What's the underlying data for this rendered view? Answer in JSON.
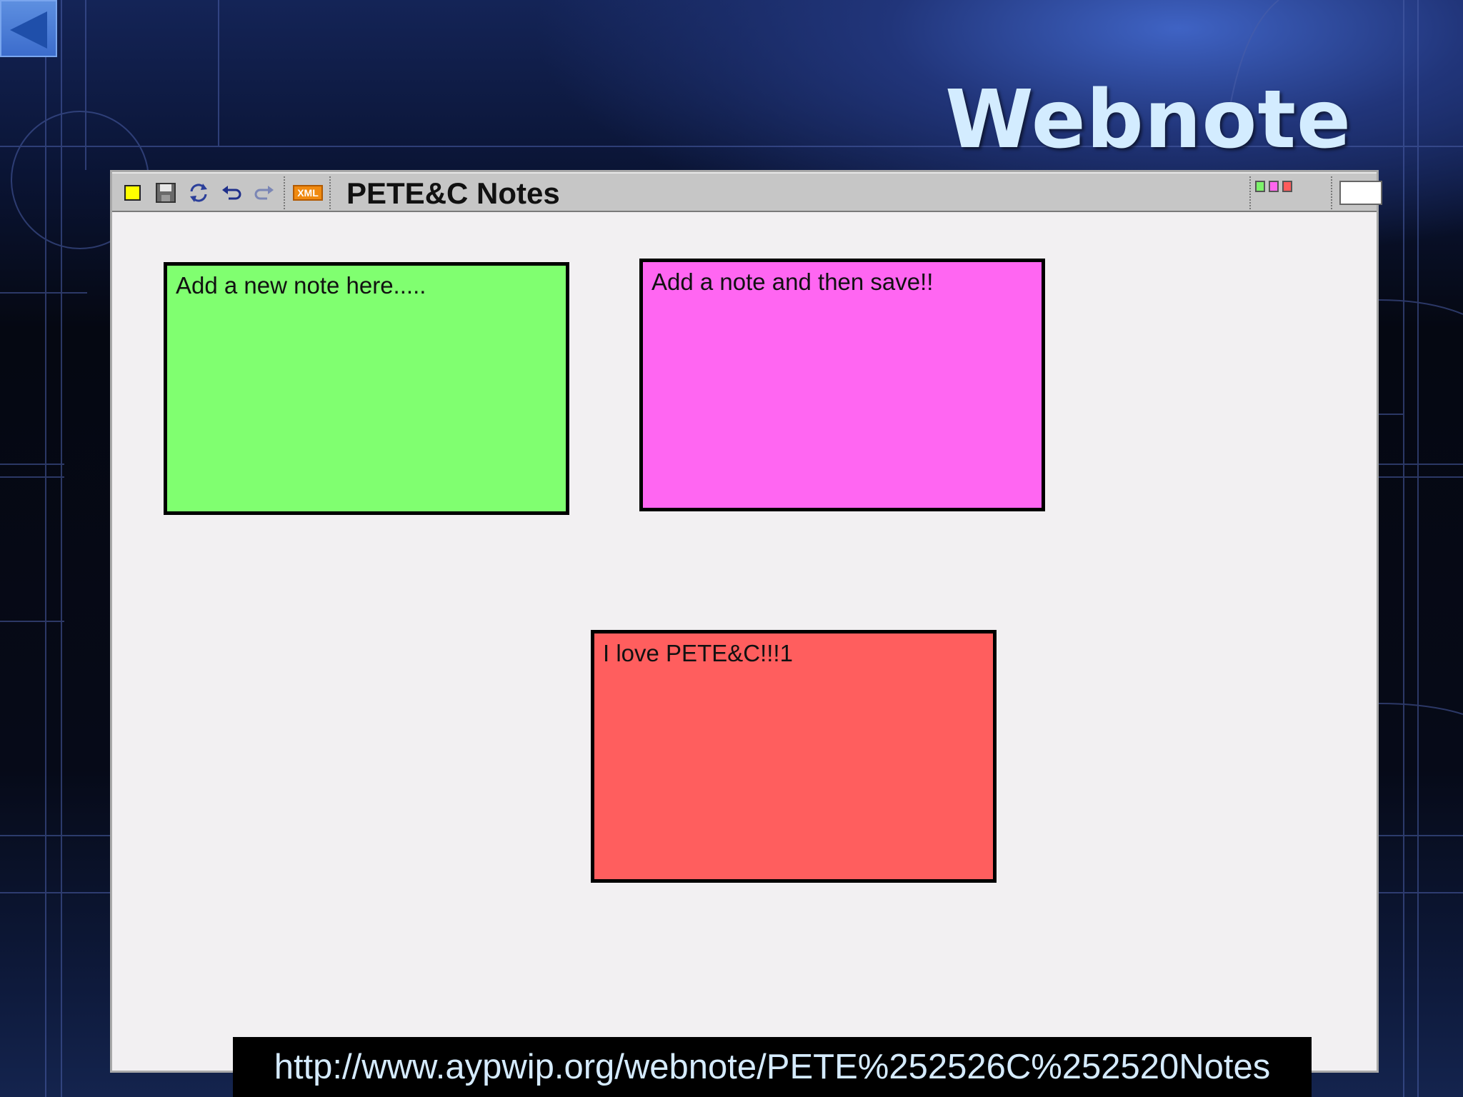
{
  "slide": {
    "title": "Webnote",
    "url": "http://www.aypwip.org/webnote/PETE%252526C%252520Notes"
  },
  "app": {
    "notebook_title": "PETE&C Notes",
    "toolbar": {
      "icons": [
        "new-note-icon",
        "save-icon",
        "reload-icon",
        "undo-icon",
        "redo-icon",
        "xml-export-icon"
      ],
      "xml_label": "XML"
    },
    "color_chips": [
      "#7cf36a",
      "#ff66ee",
      "#ff5c5c"
    ],
    "notebook_input_value": "",
    "notes": [
      {
        "text": "Add a new note here.....",
        "color": "#80ff70"
      },
      {
        "text": "Add a note and then save!!",
        "color": "#ff66f2"
      },
      {
        "text": "I love PETE&C!!!1",
        "color": "#ff5e5e"
      }
    ]
  },
  "colors": {
    "title_text": "#d3ecff",
    "window_background": "#f2f0f2",
    "toolbar_background": "#c6c6c6",
    "new_note_icon": "#ffff00",
    "back_button": "#4a7fd6"
  }
}
